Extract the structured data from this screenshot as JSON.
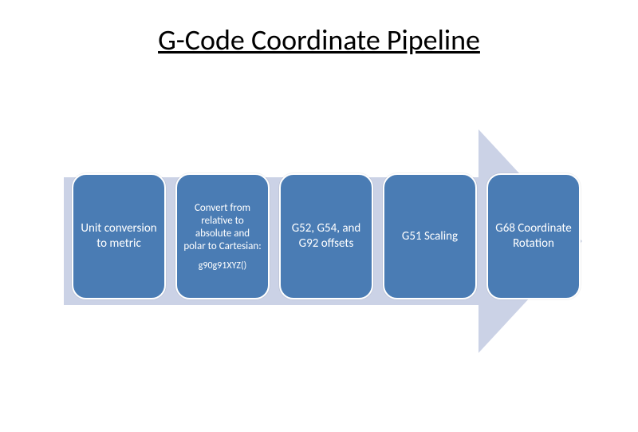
{
  "title": "G-Code Coordinate Pipeline",
  "arrow": {
    "fill": "#CBD2E6"
  },
  "cards": {
    "fill": "#4A7CB4",
    "items": [
      {
        "name": "card-unit-conversion",
        "text": "Unit conversion to metric"
      },
      {
        "name": "card-convert-relative",
        "text": "Convert from relative to absolute and polar to Cartesian:",
        "subtitle": "g90g91XYZ()"
      },
      {
        "name": "card-offsets",
        "text": "G52, G54, and G92 offsets"
      },
      {
        "name": "card-scaling",
        "text": "G51 Scaling"
      },
      {
        "name": "card-rotation",
        "text": "G68 Coordinate Rotation"
      }
    ]
  }
}
